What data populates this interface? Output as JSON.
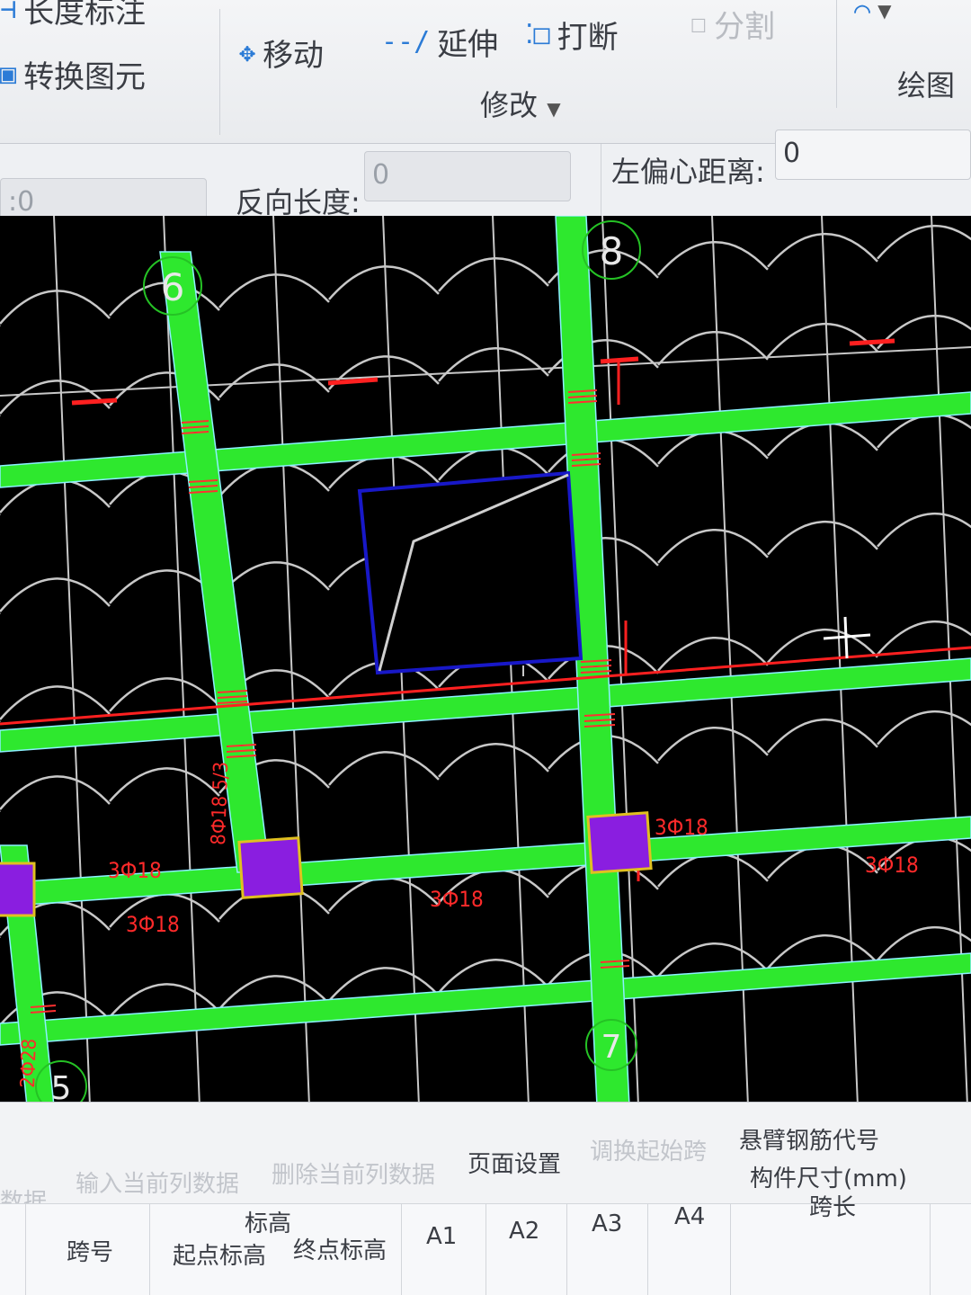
{
  "ribbon": {
    "top_left_1": "长度标注",
    "top_left_2": "转换图元",
    "move": "移动",
    "extend": "延伸",
    "break": "打断",
    "split": "分割",
    "modify_group": "修改",
    "draw_group": "绘图"
  },
  "options": {
    "first_value": ":0",
    "reverse_length_label": "反向长度:",
    "reverse_length_value": "0",
    "left_offset_label": "左偏心距离:",
    "left_offset_value": "0"
  },
  "canvas": {
    "axis_labels": [
      "6",
      "8",
      "5",
      "7"
    ],
    "rebar_labels": [
      "3Ф18",
      "3Ф18",
      "3Ф18",
      "3Ф18",
      "3Ф18",
      "8Ф18 5/3",
      "2Ф28"
    ],
    "colors": {
      "background": "#000000",
      "beam": "#2ee82e",
      "grid": "#c8c8c8",
      "rebar_text": "#ff2a2a",
      "column": "#8a1ee0",
      "selection": "#1818c8",
      "axis_circle": "#25c225"
    }
  },
  "table": {
    "toolbar": [
      "数据",
      "输入当前列数据",
      "删除当前列数据",
      "页面设置",
      "调换起始跨",
      "悬臂钢筋代号"
    ],
    "headers": {
      "span_no": "跨号",
      "elevation": "标高",
      "start_elev": "起点标高",
      "end_elev": "终点标高",
      "a1": "A1",
      "a2": "A2",
      "a3": "A3",
      "a4": "A4",
      "component_size": "构件尺寸(mm)",
      "span_length": "跨长"
    }
  }
}
